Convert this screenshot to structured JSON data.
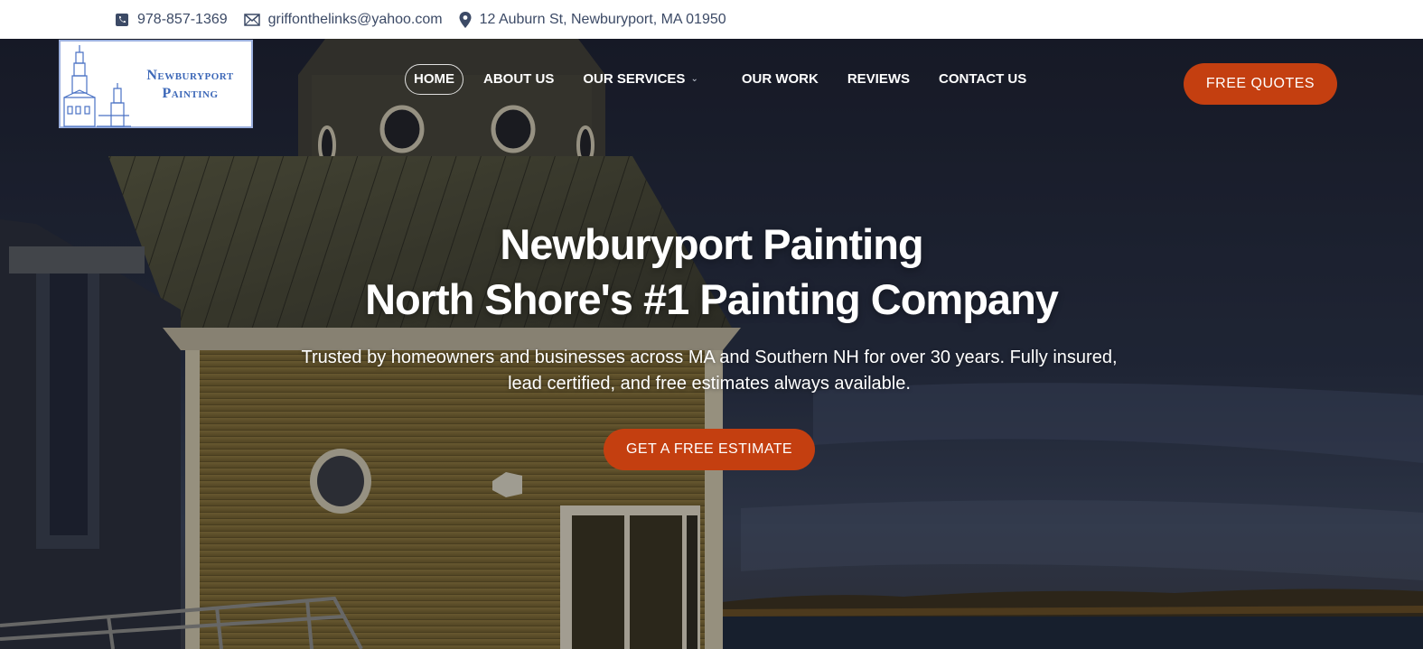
{
  "contact": {
    "phone": "978-857-1369",
    "email": "griffonthelinks@yahoo.com",
    "address": "12 Auburn St, Newburyport, MA 01950",
    "icons": [
      "phone-icon",
      "envelope-icon",
      "location-pin-icon"
    ]
  },
  "logo": {
    "line1": "Newburyport",
    "line2": "Painting"
  },
  "nav": {
    "items": [
      {
        "label": "HOME"
      },
      {
        "label": "ABOUT US"
      },
      {
        "label": "OUR SERVICES"
      },
      {
        "label": "OUR WORK"
      },
      {
        "label": "REVIEWS"
      },
      {
        "label": "CONTACT US"
      }
    ],
    "cta_label": "FREE QUOTES"
  },
  "hero": {
    "title_line1": "Newburyport Painting",
    "title_line2": "North Shore's #1 Painting Company",
    "subtitle": "Trusted by homeowners and businesses across MA and Southern NH for over 30 years. Fully insured, lead certified, and free estimates always available.",
    "cta_label": "GET A FREE ESTIMATE"
  },
  "colors": {
    "accent": "#c43f10",
    "topbar_text": "#3c4a66",
    "logo_blue": "#3d68b8"
  }
}
